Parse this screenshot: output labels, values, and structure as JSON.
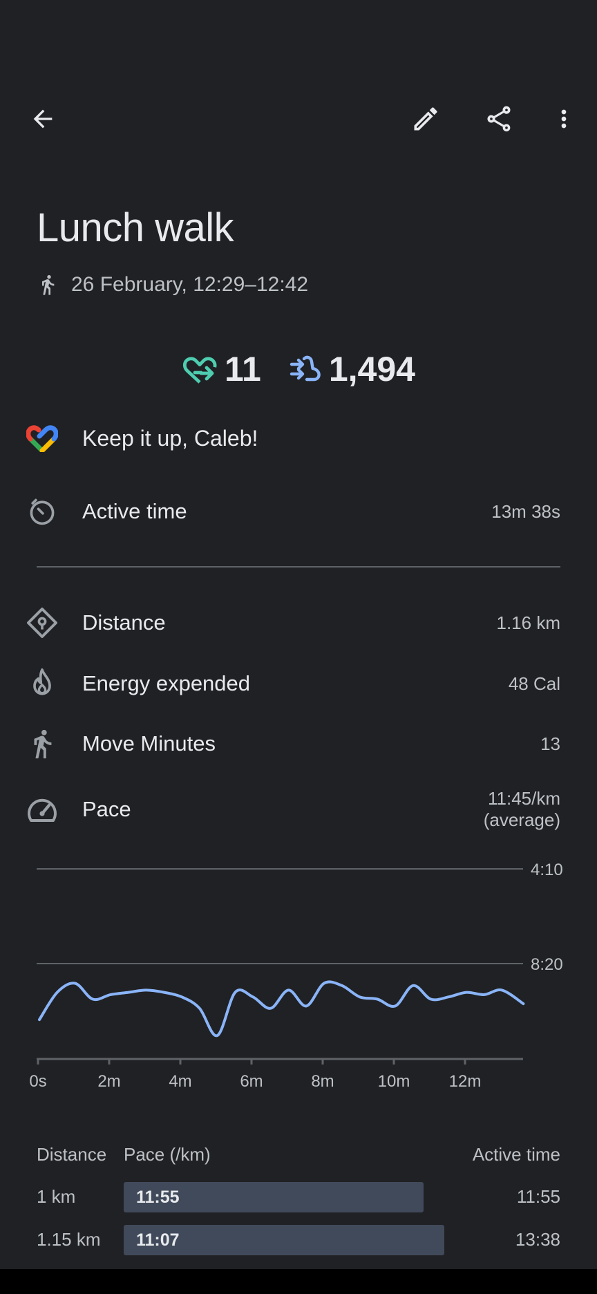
{
  "header": {
    "back_icon": "arrow-back-icon",
    "edit_icon": "pencil-icon",
    "share_icon": "share-icon",
    "more_icon": "more-vert-icon"
  },
  "activity": {
    "title": "Lunch walk",
    "type_icon": "walk-icon",
    "datetime": "26 February, 12:29–12:42"
  },
  "summary": {
    "heart_points": "11",
    "steps": "1,494",
    "heart_color": "#4ecdb0",
    "steps_color": "#8ab4f8"
  },
  "coach": {
    "message": "Keep it up, Caleb!"
  },
  "stats": [
    {
      "label": "Active time",
      "value": "13m 38s",
      "icon": "timer-icon"
    },
    {
      "label": "Distance",
      "value": "1.16 km",
      "icon": "location-diamond-icon"
    },
    {
      "label": "Energy expended",
      "value": "48 Cal",
      "icon": "flame-icon"
    },
    {
      "label": "Move Minutes",
      "value": "13",
      "icon": "walk-icon"
    },
    {
      "label": "Pace",
      "value_line1": "11:45/km",
      "value_line2": "(average)",
      "icon": "speedometer-icon"
    }
  ],
  "chart_data": {
    "type": "line",
    "title": "",
    "xlabel": "",
    "ylabel": "",
    "x_ticks": [
      "0s",
      "2m",
      "4m",
      "6m",
      "8m",
      "10m",
      "12m"
    ],
    "y_ticks": [
      "4:10",
      "8:20"
    ],
    "y_inverted": true,
    "series_color": "#8ab4f8",
    "series": [
      {
        "x_minutes": [
          0,
          0.5,
          1,
          1.5,
          2,
          2.5,
          3,
          3.5,
          4,
          4.5,
          5,
          5.5,
          6,
          6.5,
          7,
          7.5,
          8,
          8.5,
          9,
          9.5,
          10,
          10.5,
          11,
          11.5,
          12,
          12.5,
          13,
          13.6
        ],
        "pace_min_per_km": [
          10.8,
          9.6,
          9.2,
          9.9,
          9.7,
          9.6,
          9.5,
          9.6,
          9.8,
          10.3,
          11.5,
          9.6,
          9.8,
          10.3,
          9.5,
          10.2,
          9.2,
          9.3,
          9.8,
          9.9,
          10.2,
          9.3,
          9.9,
          9.8,
          9.6,
          9.7,
          9.5,
          10.1
        ]
      }
    ]
  },
  "splits": {
    "headers": {
      "distance": "Distance",
      "pace": "Pace (/km)",
      "active_time": "Active time"
    },
    "rows": [
      {
        "distance": "1 km",
        "pace": "11:55",
        "active_time": "11:55",
        "bar_fraction": 0.85
      },
      {
        "distance": "1.15 km",
        "pace": "11:07",
        "active_time": "13:38",
        "bar_fraction": 0.91
      }
    ]
  }
}
